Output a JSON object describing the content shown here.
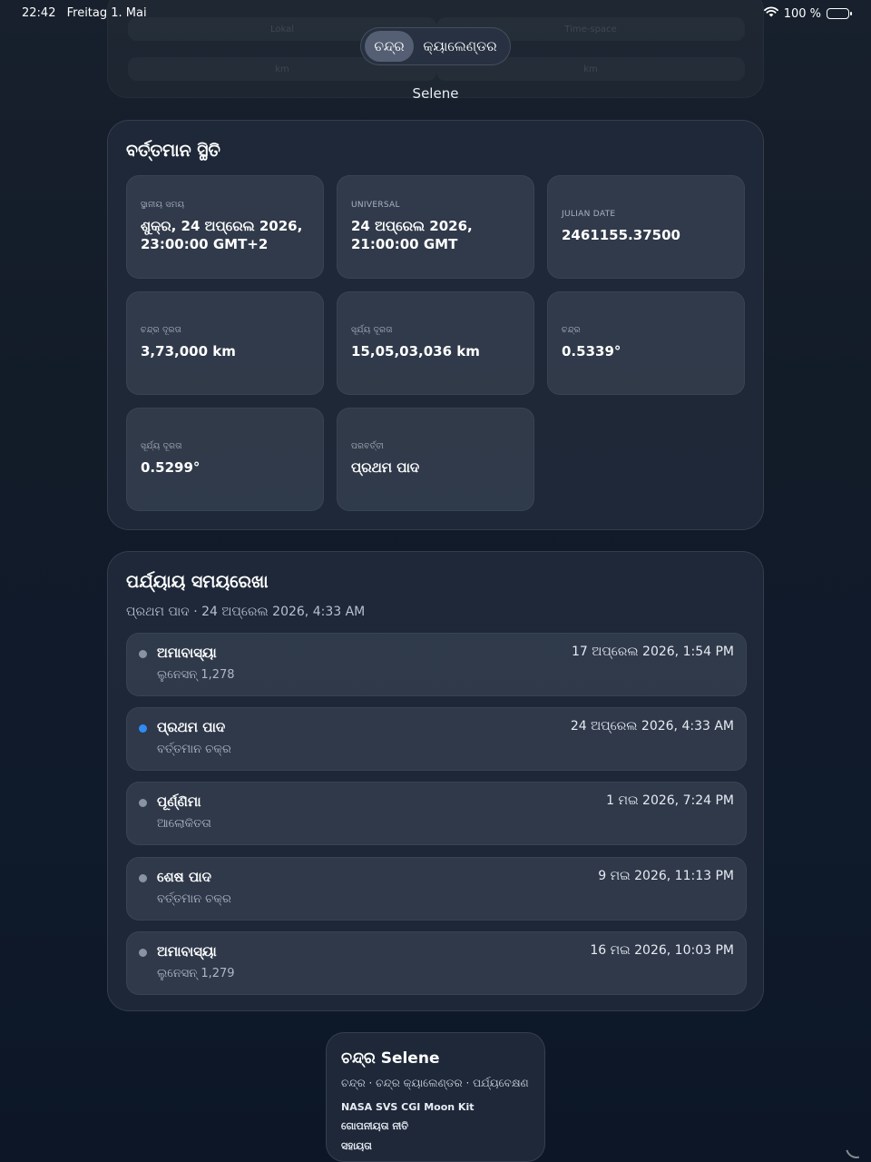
{
  "status_bar": {
    "time": "22:42",
    "date": "Freitag 1. Mai",
    "battery": "100 %"
  },
  "ghost": {
    "row1_left": "Lokal",
    "row1_right": "Time-space",
    "row2_left": "km",
    "row2_right": "km"
  },
  "tabs": [
    {
      "label": "ଚନ୍ଦ୍ର",
      "active": true
    },
    {
      "label": "କ୍ୟାଲେଣ୍ଡର",
      "active": false
    }
  ],
  "app_name": "Selene",
  "current_status": {
    "title": "ବର୍ତ୍ତମାନ ସ୍ଥିତି",
    "tiles": [
      {
        "label": "ସ୍ଥାନୀୟ ସମୟ",
        "value": "ଶୁକ୍ର, 24 ଅପ୍ରେଲ 2026,",
        "value2": "23:00:00 GMT+2"
      },
      {
        "label": "UNIVERSAL",
        "value": "24 ଅପ୍ରେଲ 2026,",
        "value2": "21:00:00 GMT"
      },
      {
        "label": "JULIAN DATE",
        "value": "2461155.37500",
        "value2": ""
      },
      {
        "label": "ଚନ୍ଦ୍ର ଦୂରତା",
        "value": "3,73,000 km",
        "value2": ""
      },
      {
        "label": "ସୂର୍ଯ୍ୟ ଦୂରତା",
        "value": "15,05,03,036 km",
        "value2": ""
      },
      {
        "label": "ଚନ୍ଦ୍ର",
        "value": "0.5339°",
        "value2": ""
      },
      {
        "label": "ସୂର୍ଯ୍ୟ ଦୂରତା",
        "value": "0.5299°",
        "value2": ""
      },
      {
        "label": "ପରବର୍ତ୍ତୀ",
        "value": "ପ୍ରଥମ ପାଦ",
        "value2": ""
      }
    ]
  },
  "timeline": {
    "title": "ପର୍ଯ୍ୟାୟ ସମୟରେଖା",
    "subtitle": "ପ୍ରଥମ ପାଦ · 24 ଅପ୍ରେଲ 2026, 4:33 AM",
    "phases": [
      {
        "name": "ଅମାବାସ୍ୟା",
        "note": "ଲୁନେସନ୍ 1,278",
        "date": "17 ଅପ୍ରେଲ 2026, 1:54 PM",
        "current": false
      },
      {
        "name": "ପ୍ରଥମ ପାଦ",
        "note": "ବର୍ତ୍ତମାନ ଚକ୍ର",
        "date": "24 ଅପ୍ରେଲ 2026, 4:33 AM",
        "current": true
      },
      {
        "name": "ପୂର୍ଣ୍ଣିମା",
        "note": "ଆଲୋକିତତା",
        "date": "1 ମଇ 2026, 7:24 PM",
        "current": false
      },
      {
        "name": "ଶେଷ ପାଦ",
        "note": "ବର୍ତ୍ତମାନ ଚକ୍ର",
        "date": "9 ମଇ 2026, 11:13 PM",
        "current": false
      },
      {
        "name": "ଅମାବାସ୍ୟା",
        "note": "ଲୁନେସନ୍ 1,279",
        "date": "16 ମଇ 2026, 10:03 PM",
        "current": false
      }
    ]
  },
  "footer": {
    "title": "ଚନ୍ଦ୍ର Selene",
    "nav": "ଚନ୍ଦ୍ର · ଚନ୍ଦ୍ର କ୍ୟାଲେଣ୍ଡର · ପର୍ଯ୍ୟବେକ୍ଷଣ",
    "links": [
      "NASA SVS CGI Moon Kit",
      "ଗୋପନୀୟତା ନୀତି",
      "ସହାୟତା"
    ]
  },
  "colors": {
    "accent_current": "#2f8cf5",
    "dot_inactive": "#8a93a2"
  }
}
